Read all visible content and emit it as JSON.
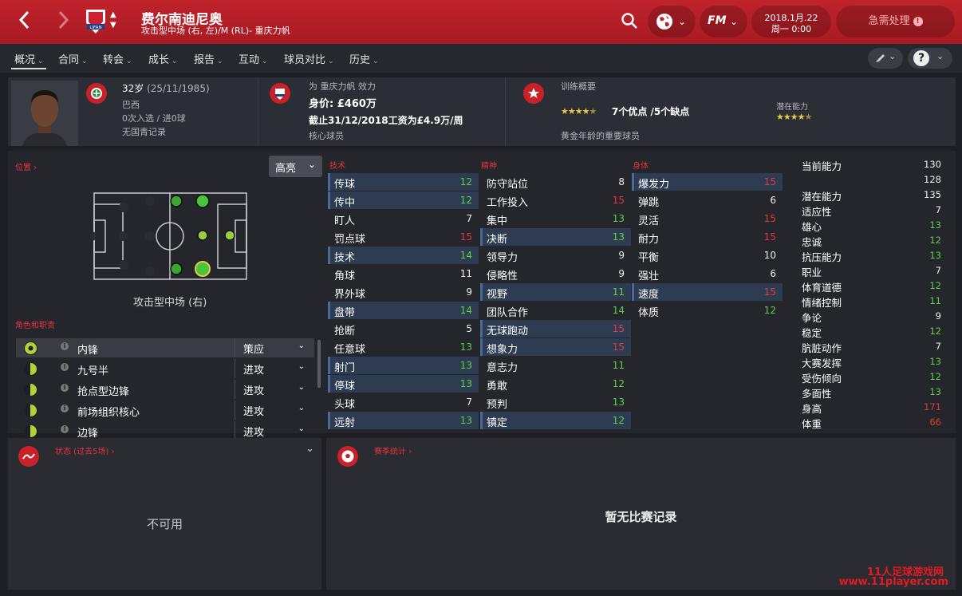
{
  "header": {
    "player_name": "费尔南迪尼奥",
    "player_position": "攻击型中场 (右, 左)/M (RL)- 重庆力帆",
    "club_logo_text": "LIFAN",
    "date_line1": "2018.1月.22",
    "date_line2": "周一 0:00",
    "urgent_label": "急需处理",
    "fm_label": "FM",
    "back_icon": "chevron-left-icon",
    "forward_icon": "chevron-right-icon"
  },
  "menu": {
    "items": [
      "概况",
      "合同",
      "转会",
      "成长",
      "报告",
      "互动",
      "球员对比",
      "历史"
    ],
    "active": "概况",
    "help_label": "?"
  },
  "info": {
    "age_line": "32岁",
    "dob": "(25/11/1985)",
    "nation": "巴西",
    "caps": "0次入选 / 进0球",
    "youth": "无国青记录",
    "club_line": "为 重庆力帆 效力",
    "value": "身价: £460万",
    "contract": "截止31/12/2018工资为£4.9万/周",
    "status": "核心球员",
    "training_title": "训练概要",
    "strengths": "7个优点 /5个缺点",
    "potential_label": "潜在能力",
    "maturity": "黄金年龄的重要球员",
    "stars_current": 4.5,
    "stars_potential": 4.5
  },
  "position": {
    "section_label": "位置 ›",
    "highlight_label": "高亮",
    "position_name": "攻击型中场 (右)"
  },
  "roles": {
    "section_label": "角色和职责",
    "items": [
      {
        "label": "内锋",
        "duty": "策应"
      },
      {
        "label": "九号半",
        "duty": "进攻"
      },
      {
        "label": "抢点型边锋",
        "duty": "进攻"
      },
      {
        "label": "前场组织核心",
        "duty": "进攻"
      },
      {
        "label": "边锋",
        "duty": "进攻"
      }
    ]
  },
  "attributes": {
    "technical_label": "技术",
    "mental_label": "精神",
    "physical_label": "身体",
    "technical": [
      {
        "name": "传球",
        "value": "12",
        "hl": true,
        "c": "g"
      },
      {
        "name": "传中",
        "value": "12",
        "hl": true,
        "c": "g"
      },
      {
        "name": "盯人",
        "value": "7",
        "hl": false,
        "c": "w"
      },
      {
        "name": "罚点球",
        "value": "15",
        "hl": false,
        "c": "r"
      },
      {
        "name": "技术",
        "value": "14",
        "hl": true,
        "c": "g"
      },
      {
        "name": "角球",
        "value": "11",
        "hl": false,
        "c": "w"
      },
      {
        "name": "界外球",
        "value": "9",
        "hl": false,
        "c": "w"
      },
      {
        "name": "盘带",
        "value": "14",
        "hl": true,
        "c": "g"
      },
      {
        "name": "抢断",
        "value": "5",
        "hl": false,
        "c": "w"
      },
      {
        "name": "任意球",
        "value": "13",
        "hl": false,
        "c": "g"
      },
      {
        "name": "射门",
        "value": "13",
        "hl": true,
        "c": "g"
      },
      {
        "name": "停球",
        "value": "13",
        "hl": true,
        "c": "g"
      },
      {
        "name": "头球",
        "value": "7",
        "hl": false,
        "c": "w"
      },
      {
        "name": "远射",
        "value": "13",
        "hl": true,
        "c": "g"
      }
    ],
    "mental": [
      {
        "name": "防守站位",
        "value": "8",
        "hl": false,
        "c": "w"
      },
      {
        "name": "工作投入",
        "value": "15",
        "hl": false,
        "c": "r"
      },
      {
        "name": "集中",
        "value": "13",
        "hl": false,
        "c": "g"
      },
      {
        "name": "决断",
        "value": "13",
        "hl": true,
        "c": "g"
      },
      {
        "name": "领导力",
        "value": "9",
        "hl": false,
        "c": "w"
      },
      {
        "name": "侵略性",
        "value": "9",
        "hl": false,
        "c": "w"
      },
      {
        "name": "视野",
        "value": "11",
        "hl": true,
        "c": "g"
      },
      {
        "name": "团队合作",
        "value": "14",
        "hl": false,
        "c": "g"
      },
      {
        "name": "无球跑动",
        "value": "15",
        "hl": true,
        "c": "r"
      },
      {
        "name": "想象力",
        "value": "15",
        "hl": true,
        "c": "r"
      },
      {
        "name": "意志力",
        "value": "11",
        "hl": false,
        "c": "g"
      },
      {
        "name": "勇敢",
        "value": "12",
        "hl": false,
        "c": "g"
      },
      {
        "name": "预判",
        "value": "13",
        "hl": false,
        "c": "g"
      },
      {
        "name": "镇定",
        "value": "12",
        "hl": true,
        "c": "g"
      }
    ],
    "physical": [
      {
        "name": "爆发力",
        "value": "15",
        "hl": true,
        "c": "r"
      },
      {
        "name": "弹跳",
        "value": "6",
        "hl": false,
        "c": "w"
      },
      {
        "name": "灵活",
        "value": "15",
        "hl": false,
        "c": "r"
      },
      {
        "name": "耐力",
        "value": "15",
        "hl": false,
        "c": "r"
      },
      {
        "name": "平衡",
        "value": "10",
        "hl": false,
        "c": "w"
      },
      {
        "name": "强壮",
        "value": "6",
        "hl": false,
        "c": "w"
      },
      {
        "name": "速度",
        "value": "15",
        "hl": true,
        "c": "r"
      },
      {
        "name": "体质",
        "value": "12",
        "hl": false,
        "c": "g"
      }
    ],
    "right": [
      {
        "name": "当前能力",
        "value": "130",
        "c": "w"
      },
      {
        "name": "",
        "value": "128",
        "c": "w"
      },
      {
        "name": "潜在能力",
        "value": "135",
        "c": "w"
      },
      {
        "name": "适应性",
        "value": "7",
        "c": "w"
      },
      {
        "name": "雄心",
        "value": "13",
        "c": "g"
      },
      {
        "name": "忠诚",
        "value": "12",
        "c": "g"
      },
      {
        "name": "抗压能力",
        "value": "13",
        "c": "g"
      },
      {
        "name": "职业",
        "value": "7",
        "c": "w"
      },
      {
        "name": "体育道德",
        "value": "12",
        "c": "g"
      },
      {
        "name": "情绪控制",
        "value": "11",
        "c": "g"
      },
      {
        "name": "争论",
        "value": "9",
        "c": "w"
      },
      {
        "name": "稳定",
        "value": "12",
        "c": "g"
      },
      {
        "name": "肮脏动作",
        "value": "7",
        "c": "w"
      },
      {
        "name": "大赛发挥",
        "value": "13",
        "c": "g"
      },
      {
        "name": "受伤倾向",
        "value": "12",
        "c": "g"
      },
      {
        "name": "多面性",
        "value": "13",
        "c": "g"
      },
      {
        "name": "身高",
        "value": "171",
        "c": "r"
      },
      {
        "name": "体重",
        "value": "66",
        "c": "r"
      }
    ]
  },
  "form": {
    "title": "状态 (过去5场) ›",
    "empty": "不可用"
  },
  "season": {
    "title": "赛季统计 ›",
    "empty": "暂无比赛记录"
  },
  "watermark": {
    "line1": "11人足球游戏网",
    "line2": "www.11player.com"
  },
  "colors": {
    "brand_red": "#b81f28",
    "good": "#5fcf4a",
    "excellent": "#e03a3a",
    "highlight_row": "#2e3c52"
  }
}
